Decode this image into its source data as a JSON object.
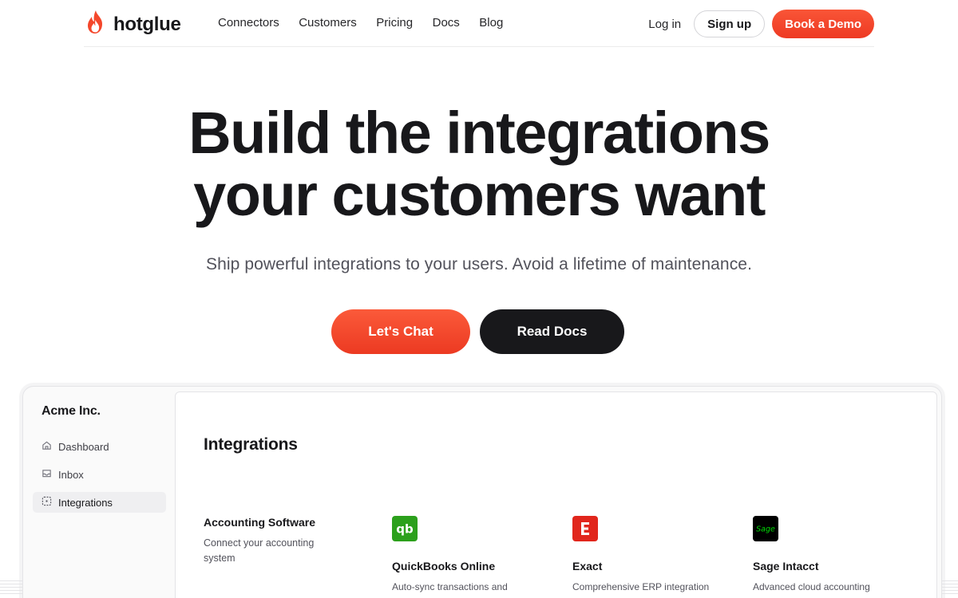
{
  "nav": {
    "brand": "hotglue",
    "links": [
      "Connectors",
      "Customers",
      "Pricing",
      "Docs",
      "Blog"
    ],
    "login": "Log in",
    "signup": "Sign up",
    "demo": "Book a Demo"
  },
  "hero": {
    "title_line1": "Build the integrations",
    "title_line2": "your customers want",
    "subtitle": "Ship powerful integrations to your users. Avoid a lifetime of maintenance.",
    "cta_primary": "Let's Chat",
    "cta_secondary": "Read Docs"
  },
  "app": {
    "company": "Acme Inc.",
    "sidebar": [
      {
        "label": "Dashboard",
        "icon": "home-icon",
        "active": false
      },
      {
        "label": "Inbox",
        "icon": "inbox-icon",
        "active": false
      },
      {
        "label": "Integrations",
        "icon": "integrations-icon",
        "active": true
      }
    ],
    "panel_title": "Integrations",
    "category": {
      "title": "Accounting Software",
      "description": "Connect your accounting system"
    },
    "cards": [
      {
        "name": "QuickBooks Online",
        "description": "Auto-sync transactions and",
        "icon": "quickbooks-icon",
        "color": "#2ca01c"
      },
      {
        "name": "Exact",
        "description": "Comprehensive ERP integration",
        "icon": "exact-icon",
        "color": "#e1261c"
      },
      {
        "name": "Sage Intacct",
        "description": "Advanced cloud accounting",
        "icon": "sage-icon",
        "color": "#000000"
      }
    ]
  },
  "colors": {
    "accent": "#f4472b",
    "dark": "#18181b",
    "sage_green": "#00dc06"
  }
}
